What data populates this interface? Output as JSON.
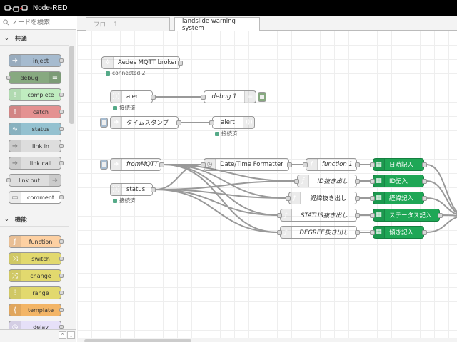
{
  "app": {
    "title": "Node-RED"
  },
  "palette": {
    "search_placeholder": "ノードを検索",
    "categories": [
      {
        "label": "共通",
        "nodes": [
          {
            "label": "inject",
            "color": "#a6bbcf",
            "icon": "arrow-right-icon",
            "side": "left"
          },
          {
            "label": "debug",
            "color": "#87a980",
            "icon": "list-icon",
            "side": "right"
          },
          {
            "label": "complete",
            "color": "#c0edc0",
            "icon": "exclamation-icon",
            "side": "left"
          },
          {
            "label": "catch",
            "color": "#e49191",
            "icon": "exclamation-icon",
            "side": "left"
          },
          {
            "label": "status",
            "color": "#94c1d0",
            "icon": "pulse-icon",
            "side": "left"
          },
          {
            "label": "link in",
            "color": "#dddddd",
            "icon": "arrow-right-icon",
            "side": "left"
          },
          {
            "label": "link call",
            "color": "#dddddd",
            "icon": "arrow-right-icon",
            "side": "left"
          },
          {
            "label": "link out",
            "color": "#dddddd",
            "icon": "arrow-right-icon",
            "side": "right"
          },
          {
            "label": "comment",
            "color": "#ffffff",
            "icon": "comment-icon",
            "side": "left"
          }
        ]
      },
      {
        "label": "機能",
        "nodes": [
          {
            "label": "function",
            "color": "#fdd0a2",
            "icon": "function-icon",
            "side": "left"
          },
          {
            "label": "switch",
            "color": "#e2d96e",
            "icon": "switch-icon",
            "side": "left"
          },
          {
            "label": "change",
            "color": "#e2d96e",
            "icon": "shuffle-icon",
            "side": "left"
          },
          {
            "label": "range",
            "color": "#e2d96e",
            "icon": "range-icon",
            "side": "left"
          },
          {
            "label": "template",
            "color": "#f3b567",
            "icon": "brace-icon",
            "side": "left"
          },
          {
            "label": "delay",
            "color": "#e6e0f8",
            "icon": "clock-icon",
            "side": "left"
          }
        ]
      }
    ]
  },
  "tabs": [
    {
      "label": "フロー 1",
      "active": false
    },
    {
      "label": "landslide warning system",
      "active": true
    }
  ],
  "flow": {
    "nodes": [
      {
        "id": "aedes",
        "label": "Aedes MQTT broker",
        "color": "#d8bfd8",
        "icon": "broker-icon",
        "status": "connected 2",
        "in": false,
        "out": true,
        "italic": false
      },
      {
        "id": "alert_in",
        "label": "alert",
        "color": "#d8bfd8",
        "icon": "wifi-icon",
        "status": "接続済",
        "in": false,
        "out": true,
        "italic": false
      },
      {
        "id": "debug1",
        "label": "debug 1",
        "color": "#87a980",
        "icon": "list-icon",
        "status": "",
        "in": true,
        "out": false,
        "italic": true
      },
      {
        "id": "timestamp",
        "label": "タイムスタンプ",
        "color": "#a6bbcf",
        "icon": "arrow-right-icon",
        "status": "",
        "in": false,
        "out": true,
        "italic": false
      },
      {
        "id": "alert_out",
        "label": "alert",
        "color": "#d8bfd8",
        "icon": "wifi-icon",
        "status": "接続済",
        "in": true,
        "out": false,
        "italic": false
      },
      {
        "id": "fromMQTT",
        "label": "fromMQTT",
        "color": "#a6bbcf",
        "icon": "arrow-right-icon",
        "status": "",
        "in": false,
        "out": true,
        "italic": true
      },
      {
        "id": "status_in",
        "label": "status",
        "color": "#d8bfd8",
        "icon": "wifi-icon",
        "status": "接続済",
        "in": false,
        "out": true,
        "italic": false
      },
      {
        "id": "dtf",
        "label": "Date/Time Formatter",
        "color": "#e6e0f8",
        "icon": "clock-icon",
        "status": "",
        "in": true,
        "out": true,
        "italic": false
      },
      {
        "id": "func1",
        "label": "function 1",
        "color": "#fdd0a2",
        "icon": "function-icon",
        "status": "",
        "in": true,
        "out": true,
        "italic": true
      },
      {
        "id": "id_extract",
        "label": "ID抜き出し",
        "color": "#fdd0a2",
        "icon": "function-icon",
        "status": "",
        "in": true,
        "out": true,
        "italic": true
      },
      {
        "id": "latlon_extract",
        "label": "経緯抜き出し",
        "color": "#fdd0a2",
        "icon": "function-icon",
        "status": "",
        "in": true,
        "out": true,
        "italic": false
      },
      {
        "id": "status_extract",
        "label": "STATUS抜き出し",
        "color": "#fdd0a2",
        "icon": "function-icon",
        "status": "",
        "in": true,
        "out": true,
        "italic": true
      },
      {
        "id": "degree_extract",
        "label": "DEGREE抜き出し",
        "color": "#fdd0a2",
        "icon": "function-icon",
        "status": "",
        "in": true,
        "out": true,
        "italic": true
      },
      {
        "id": "rec_time",
        "label": "日時記入",
        "color": "#1fa756",
        "icon": "table-icon",
        "status": "",
        "in": true,
        "out": true,
        "italic": false
      },
      {
        "id": "rec_id",
        "label": "ID記入",
        "color": "#1fa756",
        "icon": "table-icon",
        "status": "",
        "in": true,
        "out": true,
        "italic": false
      },
      {
        "id": "rec_latlon",
        "label": "経緯記入",
        "color": "#1fa756",
        "icon": "table-icon",
        "status": "",
        "in": true,
        "out": true,
        "italic": false
      },
      {
        "id": "rec_status",
        "label": "ステータス記入",
        "color": "#1fa756",
        "icon": "table-icon",
        "status": "",
        "in": true,
        "out": true,
        "italic": false
      },
      {
        "id": "rec_tilt",
        "label": "傾き記入",
        "color": "#1fa756",
        "icon": "table-icon",
        "status": "",
        "in": true,
        "out": true,
        "italic": false
      }
    ],
    "wires": [
      [
        "alert_in",
        "debug1"
      ],
      [
        "timestamp",
        "alert_out"
      ],
      [
        "fromMQTT",
        "dtf"
      ],
      [
        "fromMQTT",
        "id_extract"
      ],
      [
        "fromMQTT",
        "latlon_extract"
      ],
      [
        "fromMQTT",
        "status_extract"
      ],
      [
        "fromMQTT",
        "degree_extract"
      ],
      [
        "status_in",
        "dtf"
      ],
      [
        "status_in",
        "id_extract"
      ],
      [
        "status_in",
        "latlon_extract"
      ],
      [
        "status_in",
        "status_extract"
      ],
      [
        "status_in",
        "degree_extract"
      ],
      [
        "dtf",
        "func1"
      ],
      [
        "func1",
        "rec_time"
      ],
      [
        "id_extract",
        "rec_id"
      ],
      [
        "latlon_extract",
        "rec_latlon"
      ],
      [
        "status_extract",
        "rec_status"
      ],
      [
        "degree_extract",
        "rec_tilt"
      ],
      [
        "rec_time",
        "offscreen"
      ],
      [
        "rec_id",
        "offscreen"
      ],
      [
        "rec_latlon",
        "offscreen"
      ],
      [
        "rec_status",
        "offscreen"
      ],
      [
        "rec_tilt",
        "offscreen"
      ]
    ]
  }
}
